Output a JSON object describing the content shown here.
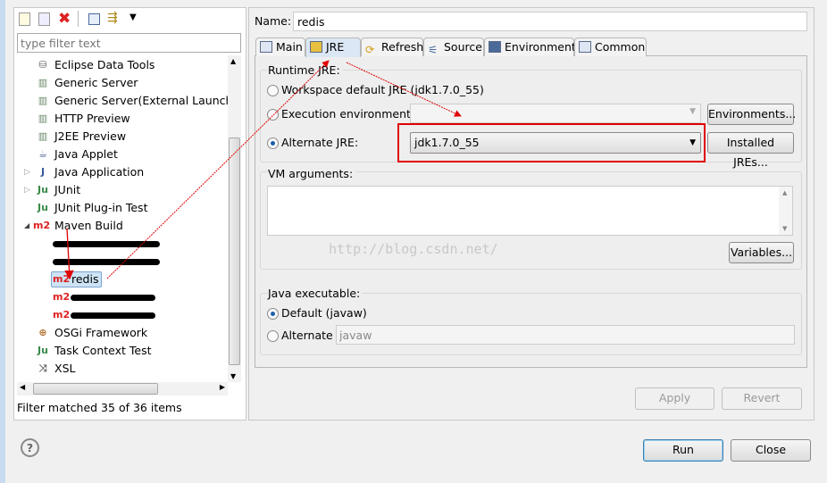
{
  "toolbar": {
    "icons": [
      "new-config-icon",
      "duplicate-icon",
      "delete-icon",
      "collapse-all-icon",
      "filter-icon",
      "dropdown-icon"
    ]
  },
  "filter": {
    "placeholder": "type filter text"
  },
  "tree": {
    "items": [
      {
        "label": "Eclipse Data Tools",
        "icon": "database-icon"
      },
      {
        "label": "Generic Server",
        "icon": "server-icon"
      },
      {
        "label": "Generic Server(External Launch)",
        "icon": "server-icon"
      },
      {
        "label": "HTTP Preview",
        "icon": "server-icon"
      },
      {
        "label": "J2EE Preview",
        "icon": "server-icon"
      },
      {
        "label": "Java Applet",
        "icon": "applet-icon"
      },
      {
        "label": "Java Application",
        "icon": "java-app-icon"
      },
      {
        "label": "JUnit",
        "icon": "junit-icon"
      },
      {
        "label": "JUnit Plug-in Test",
        "icon": "junit-plugin-icon"
      },
      {
        "label": "Maven Build",
        "icon": "m2-icon"
      },
      {
        "label": "redis",
        "icon": "m2-icon"
      },
      {
        "label": "OSGi Framework",
        "icon": "osgi-icon"
      },
      {
        "label": "Task Context Test",
        "icon": "task-icon"
      },
      {
        "label": "XSL",
        "icon": "xsl-icon"
      }
    ],
    "m2_badge": "m2",
    "status": "Filter matched 35 of 36 items"
  },
  "name": {
    "label": "Name:",
    "value": "redis"
  },
  "tabs": [
    {
      "label": "Main"
    },
    {
      "label": "JRE"
    },
    {
      "label": "Refresh"
    },
    {
      "label": "Source"
    },
    {
      "label": "Environment"
    },
    {
      "label": "Common"
    }
  ],
  "jre": {
    "group_label": "Runtime JRE:",
    "workspace_default": "Workspace default JRE (jdk1.7.0_55)",
    "execution_env": "Execution environment:",
    "alternate": "Alternate JRE:",
    "alternate_value": "jdk1.7.0_55",
    "environments_btn": "Environments...",
    "installed_btn": "Installed JREs..."
  },
  "vm": {
    "label": "VM arguments:",
    "variables_btn": "Variables..."
  },
  "watermark": "http://blog.csdn.net/",
  "java_exec": {
    "label": "Java executable:",
    "default": "Default (javaw)",
    "alternate": "Alternate",
    "alternate_value": "javaw"
  },
  "actions": {
    "apply": "Apply",
    "revert": "Revert",
    "run": "Run",
    "close": "Close",
    "help": "?"
  },
  "colors": {
    "annotation": "#e00000",
    "selection": "#cde4f7"
  }
}
